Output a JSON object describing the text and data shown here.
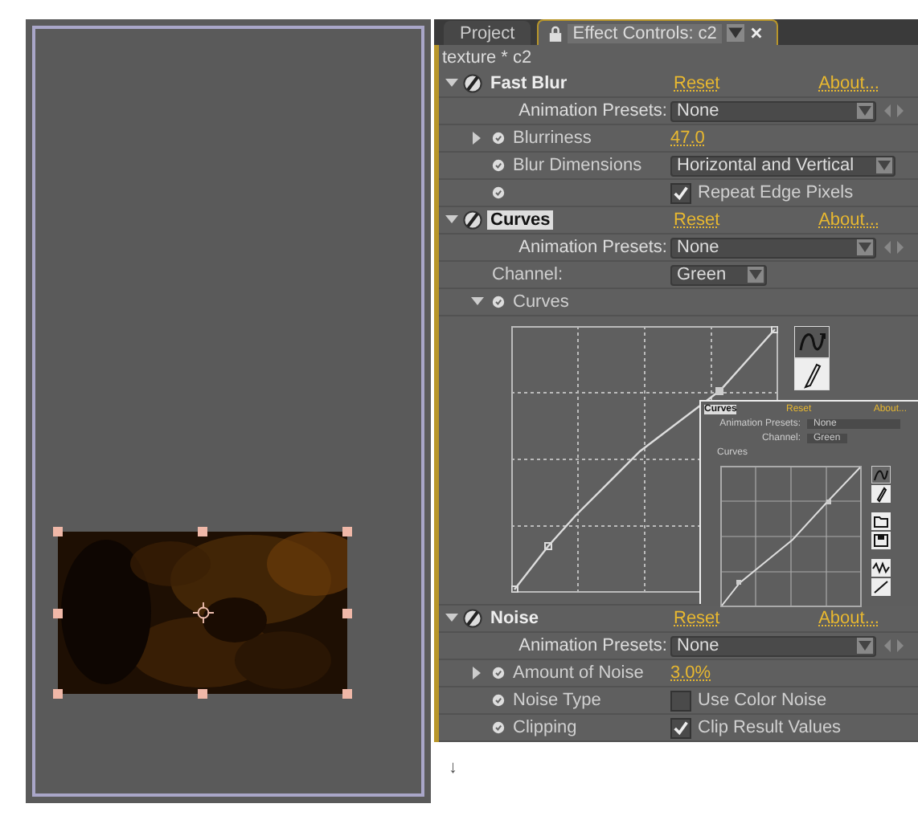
{
  "tabs": [
    {
      "label": "Project",
      "selected": false
    },
    {
      "label": "Effect Controls: c2",
      "selected": true
    }
  ],
  "layer_path": "texture * c2",
  "effects": [
    {
      "name": "Fast Blur",
      "selected": false,
      "expanded": true,
      "reset": "Reset",
      "about": "About...",
      "presets_label": "Animation Presets:",
      "presets_value": "None",
      "properties": [
        {
          "kind": "value",
          "label": "Blurriness",
          "value": "47.0",
          "expanded": false
        },
        {
          "kind": "dropdown",
          "label": "Blur Dimensions",
          "value": "Horizontal and Vertical"
        },
        {
          "kind": "checkbox",
          "text": "Repeat Edge Pixels",
          "checked": true
        }
      ]
    },
    {
      "name": "Curves",
      "selected": true,
      "expanded": true,
      "reset": "Reset",
      "about": "About...",
      "presets_label": "Animation Presets:",
      "presets_value": "None",
      "properties": [
        {
          "kind": "channel",
          "label": "Channel:",
          "value": "Green"
        },
        {
          "kind": "curves",
          "label": "Curves",
          "expanded": true
        }
      ]
    },
    {
      "name": "Noise",
      "selected": false,
      "expanded": true,
      "reset": "Reset",
      "about": "About...",
      "presets_label": "Animation Presets:",
      "presets_value": "None",
      "properties": [
        {
          "kind": "value",
          "label": "Amount of Noise",
          "value": "3.0%",
          "expanded": false
        },
        {
          "kind": "checkbox",
          "label": "Noise Type",
          "text": "Use Color Noise",
          "checked": false
        },
        {
          "kind": "checkbox",
          "label": "Clipping",
          "text": "Clip Result Values",
          "checked": true
        }
      ]
    }
  ],
  "inset": {
    "title": "Curves",
    "reset": "Reset",
    "about": "About...",
    "presets_label": "Animation Presets:",
    "presets_value": "None",
    "channel_label": "Channel:",
    "channel_value": "Green",
    "curves_label": "Curves"
  },
  "footer_mark": "↓"
}
